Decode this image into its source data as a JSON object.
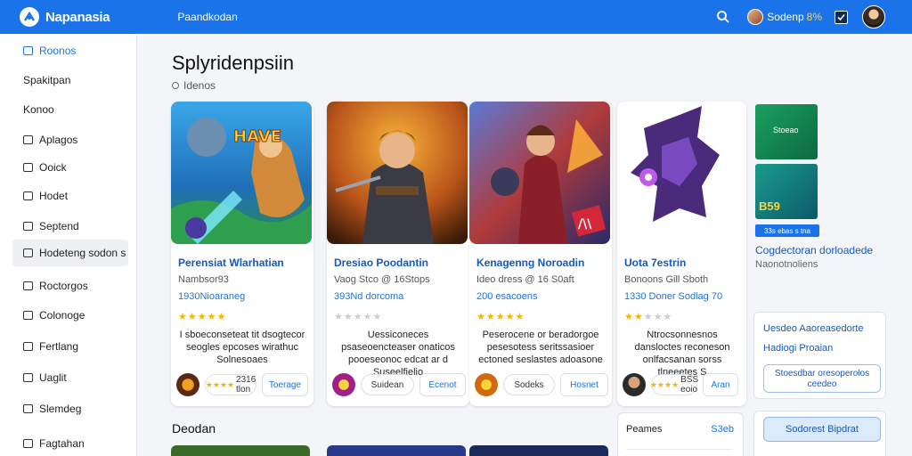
{
  "topbar": {
    "brand": "Napanasia",
    "nav_link": "Paandkodan",
    "user_name": "Sodenp",
    "user_badge": "8%"
  },
  "sidebar": {
    "items": [
      {
        "label": "Roonos"
      },
      {
        "label": "Spakitpan"
      },
      {
        "label": "Konoo"
      },
      {
        "label": "Aplagos"
      },
      {
        "label": "Ooick"
      },
      {
        "label": "Hodet"
      },
      {
        "label": "Septend"
      },
      {
        "label": "Hodeteng sodon s"
      },
      {
        "label": "Roctorgos"
      },
      {
        "label": "Colonoge"
      },
      {
        "label": "Fertlang"
      },
      {
        "label": "Uaglit"
      },
      {
        "label": "Slemdeg"
      },
      {
        "label": "Fagtahan"
      }
    ]
  },
  "main": {
    "title": "Splyridenpsiin",
    "subtitle": "Idenos",
    "cards": [
      {
        "title": "Perensiat Wlarhatian",
        "meta": "Nambsor93",
        "stat": "1930Nioaraneg",
        "rating": 5,
        "description": "I sboeconseteat tit dsogtecor seogles epcoses wirathuc Solnesoaes",
        "chip": "2316 tlon",
        "button": "Toerage"
      },
      {
        "title": "Dresiao Poodantin",
        "meta": "Vaog Stco @ 16Stops",
        "stat": "393Nd dorcoma",
        "rating": 0,
        "description": "Uessiconeces psaseoencteaser onaticos pooeseonoc edcat ar d Suseelfielio",
        "chip": "Suidean",
        "button": "Ecenot"
      },
      {
        "title": "Kenagenng Noroadin",
        "meta": "Ideo dress @ 16 S0aft",
        "stat": "200 esacoens",
        "rating": 5,
        "description": "Peserocene or beradorgoe pesesotess seritssasioer ectoned seslastes adoasone",
        "chip": "Sodeks",
        "button": "Hosnet"
      },
      {
        "title": "Uota 7estrin",
        "meta": "Bonoons Gill Sboth",
        "stat": "1330 Doner Sodlag 70",
        "rating": 2,
        "description": "Ntrocsonnesnos dansloctes reconeson onlfacsanan sorss tlneeetes S",
        "chip": "BSS eoio",
        "button": "Aran"
      }
    ],
    "right": {
      "mini_top": "Stoeao",
      "mini_bottom": "B59",
      "tag": "33s ebas s tna",
      "link": "Cogdectoran dorloadede",
      "sub": "Naonotnoliens",
      "panel_line1": "Uesdeo Aaoreasedorte",
      "panel_line2": "Hadiogi Proaian",
      "panel_button": "Stoesdbar oresoperolos ceedeo"
    },
    "bottom": {
      "title": "Deodan",
      "stat_label": "Peames",
      "stat_value": "S3eb",
      "cta": "Sodorest Bipdrat"
    }
  },
  "colors": {
    "brand": "#1a73e8",
    "link": "#1558c0",
    "star": "#f4b400"
  },
  "icons": {
    "logo": "brand-logo-icon",
    "search": "search-icon",
    "notification": "notification-icon"
  }
}
